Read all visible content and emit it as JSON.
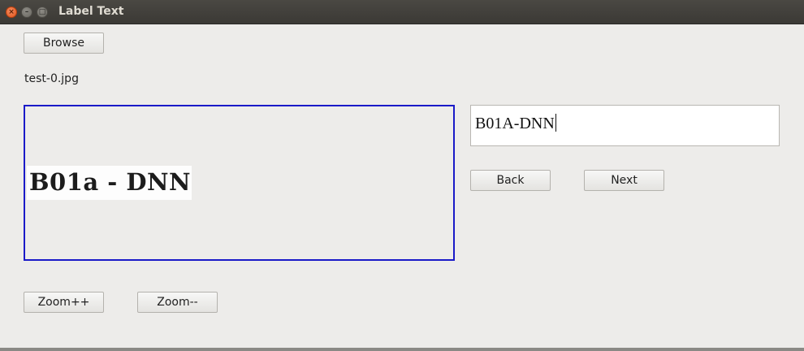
{
  "window": {
    "title": "Label Text",
    "close_glyph": "×",
    "minimize_glyph": "–",
    "maximize_glyph": "□"
  },
  "toolbar": {
    "browse_label": "Browse"
  },
  "file": {
    "name": "test-0.jpg"
  },
  "preview": {
    "image_text": "B01a - DNN"
  },
  "label_field": {
    "value": "B01A-DNN"
  },
  "nav": {
    "back_label": "Back",
    "next_label": "Next"
  },
  "zoom": {
    "in_label": "Zoom++",
    "out_label": "Zoom--"
  },
  "colors": {
    "image_frame": "#1a1ac8",
    "close_button": "#e0561f",
    "titlebar": "#3b3935"
  }
}
